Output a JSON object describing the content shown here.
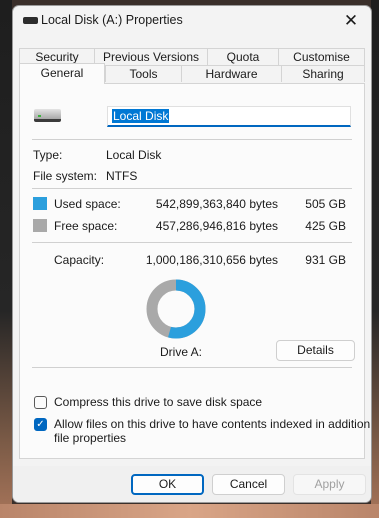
{
  "window": {
    "title": "Local Disk (A:) Properties",
    "close_glyph": "✕"
  },
  "tabs_row1": [
    "Security",
    "Previous Versions",
    "Quota",
    "Customise"
  ],
  "tabs_row2": [
    "General",
    "Tools",
    "Hardware",
    "Sharing"
  ],
  "selected_tab": "General",
  "general": {
    "drive_name": "Local Disk",
    "type_label": "Type:",
    "type_value": "Local Disk",
    "fs_label": "File system:",
    "fs_value": "NTFS",
    "used_label": "Used space:",
    "used_bytes": "542,899,363,840 bytes",
    "used_size": "505 GB",
    "free_label": "Free space:",
    "free_bytes": "457,286,946,816 bytes",
    "free_size": "425 GB",
    "capacity_label": "Capacity:",
    "capacity_bytes": "1,000,186,310,656 bytes",
    "capacity_size": "931 GB",
    "used_fraction": 0.5428,
    "drive_label": "Drive A:",
    "details_button": "Details",
    "compress_label": "Compress this drive to save disk space",
    "compress_checked": false,
    "index_label_line1": "Allow files on this drive to have contents indexed in addition to",
    "index_label_line2": "file properties",
    "index_checked": true
  },
  "colors": {
    "used": "#2b9fdd",
    "free": "#a9a9a9",
    "accent": "#0067c0"
  },
  "footer": {
    "ok": "OK",
    "cancel": "Cancel",
    "apply": "Apply"
  }
}
